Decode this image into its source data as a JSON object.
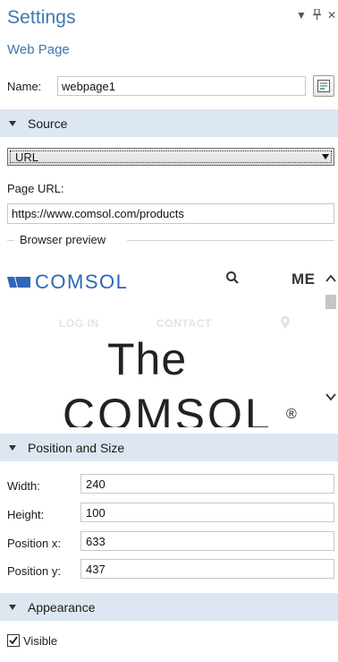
{
  "panel": {
    "title": "Settings",
    "subtitle": "Web Page",
    "controls": {
      "pin_icon": "pin-icon",
      "close_icon": "close-icon",
      "menu_icon": "dropdown-arrow-icon"
    }
  },
  "name_field": {
    "label": "Name:",
    "value": "webpage1",
    "button_icon": "form-editor-icon"
  },
  "sections": {
    "source": "Source",
    "position_size": "Position and Size",
    "appearance": "Appearance"
  },
  "source": {
    "type_selected": "URL",
    "page_url_label": "Page URL:",
    "page_url_value": "https://www.comsol.com/products",
    "browser_preview_label": "Browser preview"
  },
  "preview": {
    "logo_text": "COMSOL",
    "menu_text": "ME",
    "links": [
      "LOG IN",
      "CONTACT"
    ],
    "headline_line1": "The",
    "headline_line2": "COMSOL",
    "reg_mark": "®"
  },
  "position_size": {
    "fields": [
      {
        "label": "Width:",
        "value": "240"
      },
      {
        "label": "Height:",
        "value": "100"
      },
      {
        "label": "Position x:",
        "value": "633"
      },
      {
        "label": "Position y:",
        "value": "437"
      }
    ]
  },
  "appearance": {
    "visible_label": "Visible",
    "visible_checked": true
  },
  "colors": {
    "accent": "#3c78b4",
    "section_bg": "#dde7f2",
    "logo": "#2e66b8"
  }
}
